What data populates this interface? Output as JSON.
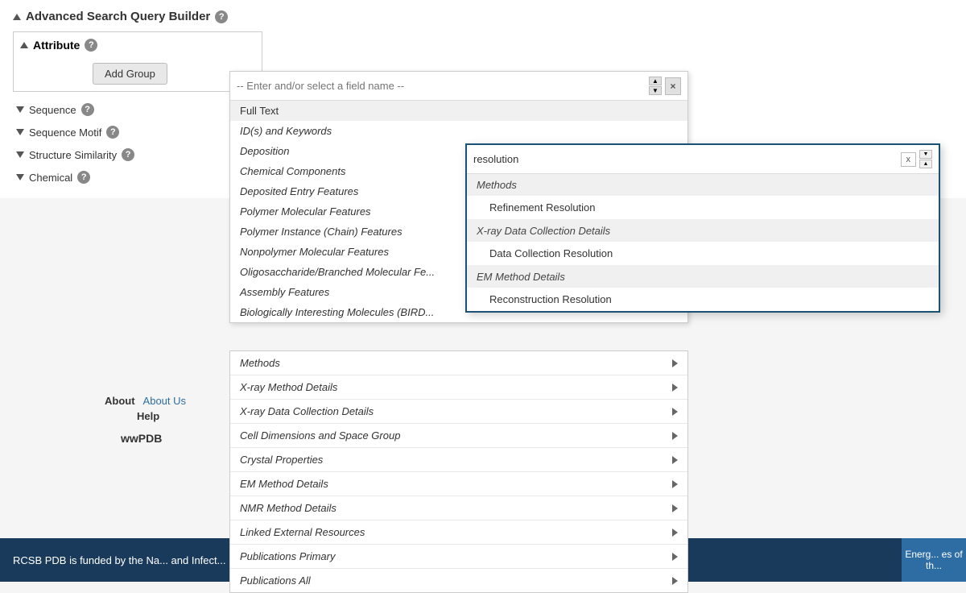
{
  "header": {
    "title": "Advanced Search Query Builder",
    "help_icon": "?"
  },
  "attribute_section": {
    "label": "Attribute",
    "add_group_label": "Add Group"
  },
  "sidebar_items": [
    {
      "label": "Sequence",
      "has_help": true
    },
    {
      "label": "Sequence Motif",
      "has_help": true
    },
    {
      "label": "Structure Similarity",
      "has_help": true
    },
    {
      "label": "Chemical",
      "has_help": true
    }
  ],
  "field_search": {
    "placeholder": "-- Enter and/or select a field name --"
  },
  "dropdown_items": [
    {
      "label": "Full Text",
      "italic": false
    },
    {
      "label": "ID(s) and Keywords",
      "italic": true
    },
    {
      "label": "Deposition",
      "italic": true
    },
    {
      "label": "Chemical Components",
      "italic": true
    },
    {
      "label": "Deposited Entry Features",
      "italic": true
    },
    {
      "label": "Polymer Molecular Features",
      "italic": true
    },
    {
      "label": "Polymer Instance (Chain) Features",
      "italic": true
    },
    {
      "label": "Nonpolymer Molecular Features",
      "italic": true
    },
    {
      "label": "Oligosaccharide/Branched Molecular Fe...",
      "italic": true
    },
    {
      "label": "Assembly Features",
      "italic": true
    },
    {
      "label": "Biologically Interesting Molecules (BIRD...",
      "italic": true
    }
  ],
  "dropdown_rows": [
    {
      "label": "Methods"
    },
    {
      "label": "X-ray Method Details"
    },
    {
      "label": "X-ray Data Collection Details"
    },
    {
      "label": "Cell Dimensions and Space Group"
    },
    {
      "label": "Crystal Properties"
    },
    {
      "label": "EM Method Details"
    },
    {
      "label": "NMR Method Details"
    },
    {
      "label": "Linked External Resources"
    },
    {
      "label": "Publications Primary"
    },
    {
      "label": "Publications All"
    }
  ],
  "resolution_popup": {
    "search_value": "resolution",
    "groups": [
      {
        "header": "Methods",
        "items": [
          "Refinement Resolution"
        ]
      },
      {
        "header": "X-ray Data Collection Details",
        "items": [
          "Data Collection Resolution"
        ]
      },
      {
        "header": "EM Method Details",
        "items": [
          "Reconstruction Resolution"
        ]
      }
    ]
  },
  "footer": {
    "text": "RCSB PDB is funded by the Na... and Infect...",
    "right_text": "Energ... es of th..."
  },
  "about": {
    "label": "About",
    "about_us_link": "About Us",
    "help_label": "Help",
    "wwpdb_label": "wwPDB"
  },
  "icons": {
    "sort_up": "▲",
    "sort_down": "▼",
    "clear": "×",
    "arrow_right": "▶"
  }
}
